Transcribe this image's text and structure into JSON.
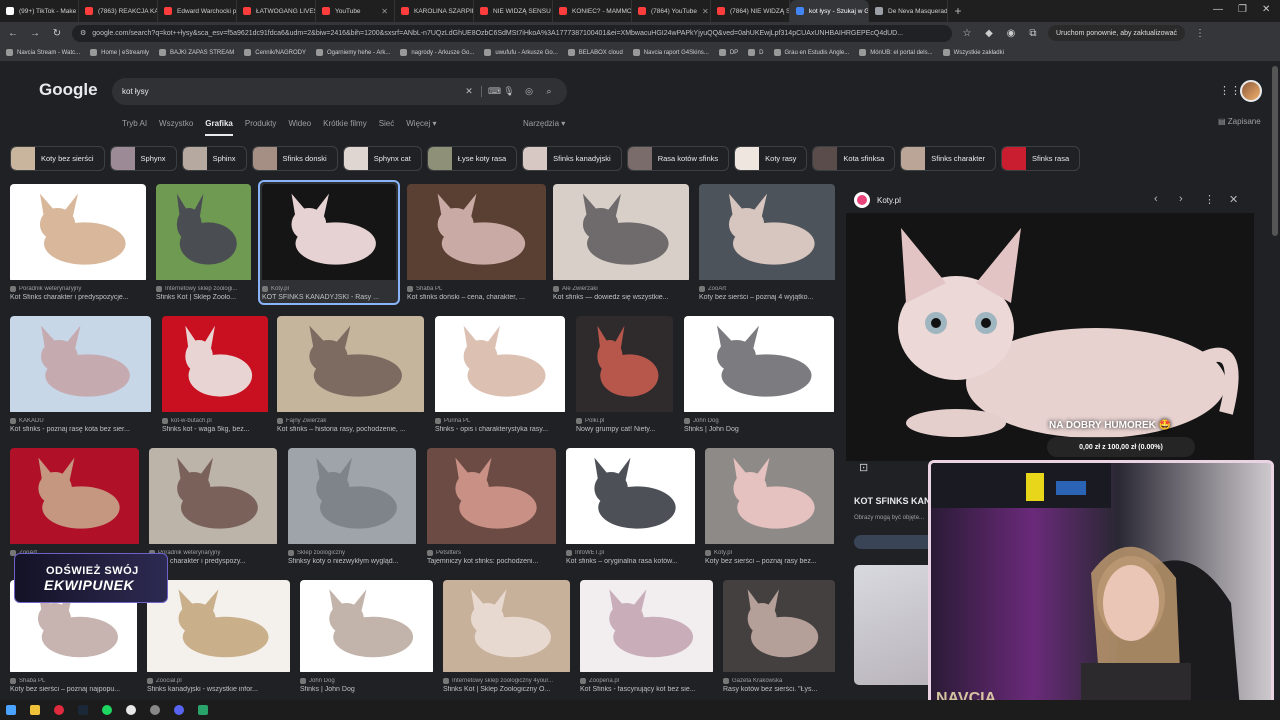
{
  "tabs": [
    {
      "title": "(99+) TikTok - Make Yo",
      "color": "#ffffff"
    },
    {
      "title": "(7863) REAKCJA KASI",
      "color": "#ff3d3d"
    },
    {
      "title": "Edward Warchocki po",
      "color": "#ff3d3d"
    },
    {
      "title": "ŁATWOGANG LIVESTR",
      "color": "#ff3d3d"
    },
    {
      "title": "YouTube",
      "color": "#ff3d3d"
    },
    {
      "title": "KAROLINA SZARPIE M",
      "color": "#ff3d3d"
    },
    {
      "title": "NIE WIDZĄ SENSU ŻY",
      "color": "#ff3d3d"
    },
    {
      "title": "KONIEC? - MAMMON",
      "color": "#ff3d3d"
    },
    {
      "title": "(7864) YouTube",
      "color": "#ff3d3d"
    },
    {
      "title": "(7864) NIE WIDZĄ SE",
      "color": "#ff3d3d"
    },
    {
      "title": "kot łysy - Szukaj w Go",
      "color": "#4285f4",
      "active": true
    },
    {
      "title": "De Neva Masquerade",
      "color": "#9aa0a6"
    }
  ],
  "url": "google.com/search?q=kot++łysy&sca_esv=f5a9621dc91fdca6&udm=2&biw=2416&bih=1200&sxsrf=ANbL-n7UQzLdGhUE8OzbC6SdMSt7iHkoA%3A1777387100401&ei=XMbwacuHGI24wPAPkYjyuQQ&ved=0ahUKEwjLpf314pCUAxUNHBAIHRGEPEcQ4dUD...",
  "restart_label": "Uruchom ponownie, aby zaktualizować",
  "bookmarks": [
    "Navcia Stream - Watc...",
    "Home | eStreamly",
    "BAJKI ZAPAS STREAM",
    "Cennik/NAGRODY",
    "Ogarniemy hehe - Ark...",
    "nagrody - Arkusze Go...",
    "uwufufu - Arkusze Go...",
    "BELABOX cloud",
    "Navcia raport G4Skins...",
    "DP",
    "D",
    "Grau en Estudis Angle...",
    "MónUB: el portal dels...",
    "Wszystkie zakładki"
  ],
  "google": {
    "logo": "Google",
    "query": "kot łysy",
    "nav": [
      "Tryb AI",
      "Wszystko",
      "Grafika",
      "Produkty",
      "Wideo",
      "Krótkie filmy",
      "Sieć",
      "Więcej ▾"
    ],
    "active_nav": "Grafika",
    "tools": "Narzędzia ▾",
    "saved": "Zapisane"
  },
  "chips": [
    {
      "label": "Koty bez sierści",
      "color": "#c9b59e"
    },
    {
      "label": "Sphynx",
      "color": "#9c8a96"
    },
    {
      "label": "Sphinx",
      "color": "#b5a9a0"
    },
    {
      "label": "Sfinks donski",
      "color": "#a58e84"
    },
    {
      "label": "Sphynx cat",
      "color": "#e0d6d1"
    },
    {
      "label": "Łyse koty rasa",
      "color": "#8e9078"
    },
    {
      "label": "Sfinks kanadyjski",
      "color": "#d7c8c4"
    },
    {
      "label": "Rasa kotów sfinks",
      "color": "#7a6c6a"
    },
    {
      "label": "Koty rasy",
      "color": "#f0e6e0"
    },
    {
      "label": "Kota sfinksa",
      "color": "#5a4c4a"
    },
    {
      "label": "Sfinks charakter",
      "color": "#bba596"
    },
    {
      "label": "Sfinks rasa",
      "color": "#c81e2f"
    }
  ],
  "results": [
    {
      "source": "Poradnik weterynaryjny",
      "title": "Kot Sfinks charakter i predyspozycje...",
      "c1": "#ffffff",
      "c2": "#d8b79a"
    },
    {
      "source": "Internetowy sklep zoologi...",
      "title": "Sfinks Kot | Sklep Zoolo...",
      "c1": "#6e9a52",
      "c2": "#4a4d52"
    },
    {
      "source": "Koty.pl",
      "title": "KOT SFINKS KANADYJSKI - Rasy ...",
      "c1": "#151515",
      "c2": "#e6d2d2"
    },
    {
      "source": "Shaba PL",
      "title": "Kot sfinks doński – cena, charakter, ...",
      "c1": "#5a3f33",
      "c2": "#c9aaa5"
    },
    {
      "source": "Ale Zwierzaki",
      "title": "Kot sfinks — dowiedz się wszystkie...",
      "c1": "#d8cfc8",
      "c2": "#6f6a6b"
    },
    {
      "source": "ZooArt",
      "title": "Koty bez sierści – poznaj 4 wyjątko...",
      "c1": "#4d535a",
      "c2": "#d7c5bf"
    },
    {
      "source": "KAKADU",
      "title": "Kot sfinks - poznaj rasę kota bez sier...",
      "c1": "#c7d7e8",
      "c2": "#c5aab0"
    },
    {
      "source": "kot-w-butach.pl",
      "title": "Sfinks kot - waga 5kg, bez...",
      "c1": "#c81021",
      "c2": "#e8d5d3"
    },
    {
      "source": "Fajny Zwierzak",
      "title": "Kot sfinks – historia rasy, pochodzenie, ...",
      "c1": "#c5b59d",
      "c2": "#7d6a61"
    },
    {
      "source": "Purina PL",
      "title": "Sfinks - opis i charakterystyka rasy...",
      "c1": "#ffffff",
      "c2": "#dcc1b3"
    },
    {
      "source": "Polki.pl",
      "title": "Nowy grumpy cat! Niety...",
      "c1": "#2f2a2c",
      "c2": "#b7574b"
    },
    {
      "source": "John Dog",
      "title": "Sfinks | John Dog",
      "c1": "#ffffff",
      "c2": "#7b7b80"
    },
    {
      "source": "ZooArt",
      "title": "",
      "c1": "#b01028",
      "c2": "#c69780"
    },
    {
      "source": "Poradnik weterynaryjny",
      "title": "Sfinks charakter i predyspozy...",
      "c1": "#bcb3a9",
      "c2": "#7a625a"
    },
    {
      "source": "Sklep zoologiczny",
      "title": "Sfinksy koty o niezwykłym wygląd...",
      "c1": "#9fa4aa",
      "c2": "#7e8489"
    },
    {
      "source": "Petsitters",
      "title": "Tajemniczy kot sfinks: pochodzeni...",
      "c1": "#6b4b44",
      "c2": "#c99185"
    },
    {
      "source": "InfoWET.pl",
      "title": "Kot sfinks – oryginalna rasa kotów...",
      "c1": "#ffffff",
      "c2": "#4d5157"
    },
    {
      "source": "Koty.pl",
      "title": "Koty bez sierści – poznaj rasy bez...",
      "c1": "#8e8a87",
      "c2": "#e5c1bf"
    },
    {
      "source": "Shaba PL",
      "title": "Koty bez sierści – poznaj najpopu...",
      "c1": "#ffffff",
      "c2": "#c7b3b0"
    },
    {
      "source": "Zoocial.pl",
      "title": "Sfinks kanadyjski - wszystkie infor...",
      "c1": "#f4f1ec",
      "c2": "#c9b08b"
    },
    {
      "source": "John Dog",
      "title": "Sfinks | John Dog",
      "c1": "#ffffff",
      "c2": "#c2b4ab"
    },
    {
      "source": "Internetowy sklep zoologiczny 4your...",
      "title": "Sfinks Kot | Sklep Zoologiczny O...",
      "c1": "#c7b19a",
      "c2": "#e8d9d0"
    },
    {
      "source": "Zooperia.pl",
      "title": "Kot Sfinks - fascynujący kot bez sie...",
      "c1": "#f2eef0",
      "c2": "#c9aeb9"
    },
    {
      "source": "Gazeta Krakowska",
      "title": "Rasy kotów bez sierści. \"Łys...",
      "c1": "#454040",
      "c2": "#b5a099"
    }
  ],
  "panel": {
    "site": "Koty.pl",
    "title": "KOT SFINKS KAN",
    "disclaimer": "Obrazy mogą być objęte..."
  },
  "stream": {
    "donate_title": "NA DOBRY HUMOREK 🤩",
    "donate_progress": "0,00 zł z 100,00 zł (0.00%)",
    "overlay_line1": "ODŚWIEŻ SWÓJ",
    "overlay_line2": "EKWIPUNEK",
    "cam_label": "NAVCIA"
  }
}
